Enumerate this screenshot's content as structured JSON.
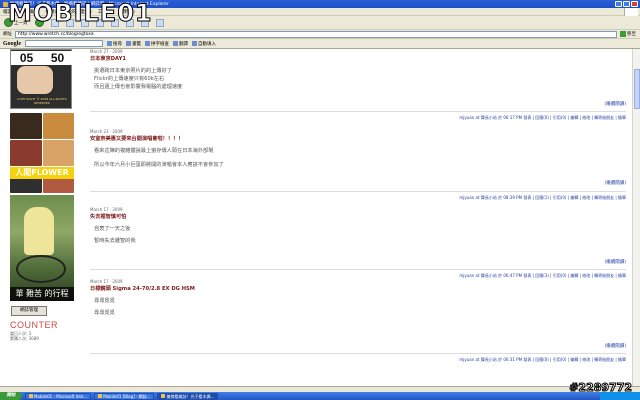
{
  "browser": {
    "window_title": "擁擠看雜誌！光子看木偶 - 擁擠看雜誌 | 網誌看 - Microsoft Internet Explorer",
    "menu": [
      "檔案(F)",
      "編輯(E)",
      "檢視(V)",
      "我的最愛(A)",
      "工具(T)",
      "說明(H)"
    ],
    "back_label": "上一頁",
    "address_label": "網址",
    "url": "http://www.wretch.cc/blog/egtoxa",
    "go_label": "移至",
    "google_logo": "Google",
    "google_buttons": [
      "搜尋",
      "書籤",
      "拼字檢查",
      "翻譯",
      "自動填入"
    ],
    "watermark": "MOBILE01",
    "bottom_watermark": "#2289772"
  },
  "sidebar": {
    "calendar_dates": [
      "05",
      "50"
    ],
    "calendar_caption": "COPY RIGHT © 2008 ALL RIGHTS RESERVED",
    "photo_banner_title": "人間FLOWER",
    "big_photo_label": "單 難苦 的行程",
    "manage_button": "網誌管理",
    "counter_title": "COUNTER",
    "counter_lines": [
      "當日人次: 3",
      "累積人次: 3089"
    ]
  },
  "posts": [
    {
      "date": "March 27 · 2009",
      "title": "日本東京DAY1",
      "body": [
        "挑選跨日本東京照片的的上傳好了",
        "Flickr的上傳速度只有60k左右",
        "而且還上傳也會影響我電腦的處理速度"
      ],
      "more": "(繼續閱讀)",
      "meta_user": "mjyuan",
      "meta_text": "at 舞長小站 於 06:17 PM 發表 | 回應(0) | 引用(0) | 編輯 | 修改 | 轉寄給朋友 | 檢舉"
    },
    {
      "date": "March 23 · 2009",
      "title": "安室奈美惠又要來台開演唱會啦！！！！",
      "body": [
        "看來這陣的複雜體說最上蠻存傳人頭在日本海外部場",
        "所以今年六月小巨蛋即將開的演唱會本人應該不會參加了"
      ],
      "more": "(繼續閱讀)",
      "meta_user": "mjyuan",
      "meta_text": "at 舞長小站 於 08:39 PM 發表 | 回應(1) | 引用(0) | 編輯 | 修改 | 轉寄給朋友 | 檢舉"
    },
    {
      "date": "March 17 · 2009",
      "title": "失去裡智慎可怕",
      "body": [
        "自衷了一天之後",
        "暫時失去邏智的我"
      ],
      "more": "(繼續閱讀)",
      "meta_user": "mjyuan",
      "meta_text": "at 舞長小站 於 06:47 PM 發表 | 回應(3) | 引用(0) | 編輯 | 修改 | 轉寄給朋友 | 檢舉"
    },
    {
      "date": "March 17 · 2009",
      "title": "日標鏡頭 Sigma 24-70/2.8 EX DG HSM",
      "body": [
        "尋尋覓覓",
        "尋尋覓覓"
      ],
      "more": "(繼續閱讀)",
      "meta_user": "mjyuan",
      "meta_text": "at 舞長小站 於 06:31 PM 發表 | 回應(0) | 引用(0) | 編輯 | 修改 | 轉寄給朋友 | 檢舉"
    }
  ],
  "taskbar": {
    "start": "開始",
    "tasks": [
      "Mobile01 - Microsoft Inte...",
      "Mobile01 [Blog] - 網誌...",
      "擁擠看雜誌！光子看木偶..."
    ]
  }
}
